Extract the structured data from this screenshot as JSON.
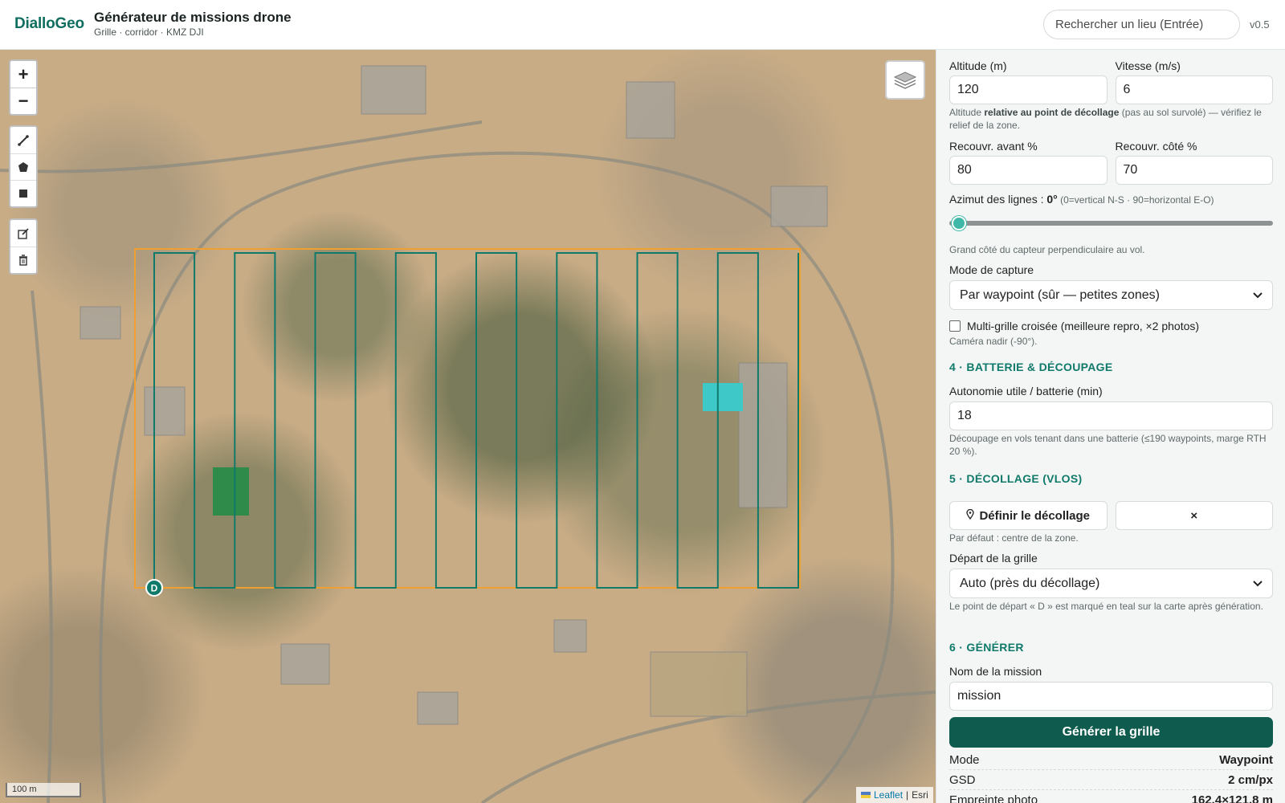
{
  "header": {
    "brand": "DialloGeo",
    "title": "Générateur de missions drone",
    "subtitle": "Grille · corridor · KMZ DJI",
    "search_placeholder": "Rechercher un lieu (Entrée)",
    "version": "v0.5"
  },
  "map": {
    "zoom_in": "+",
    "zoom_out": "−",
    "scale_label": "100 m",
    "attribution_leaflet": "Leaflet",
    "attribution_sep": "|",
    "attribution_esri": "Esri",
    "start_marker": "D",
    "grid_lines": 17,
    "colors": {
      "zone": "#f0a030",
      "grid": "#0f7a6a",
      "marker": "#0f7a6a"
    }
  },
  "sidebar": {
    "altitude": {
      "label": "Altitude (m)",
      "value": "120"
    },
    "speed": {
      "label": "Vitesse (m/s)",
      "value": "6"
    },
    "altitude_help_1": "Altitude ",
    "altitude_help_bold": "relative au point de décollage",
    "altitude_help_2": " (pas au sol survolé) — vérifiez le relief de la zone.",
    "overlap_front": {
      "label": "Recouvr. avant %",
      "value": "80"
    },
    "overlap_side": {
      "label": "Recouvr. côté %",
      "value": "70"
    },
    "azimuth_label": "Azimut des lignes : ",
    "azimuth_value": "0°",
    "azimuth_hint": " (0=vertical N-S · 90=horizontal E-O)",
    "azimuth_level": 0,
    "sensor_help": "Grand côté du capteur perpendiculaire au vol.",
    "capture_mode_label": "Mode de capture",
    "capture_mode_value": "Par waypoint (sûr — petites zones)",
    "multigrid_label": "Multi-grille croisée (meilleure repro, ×2 photos)",
    "multigrid_checked": false,
    "camera_help": "Caméra nadir (-90°).",
    "section4": "4 · BATTERIE & DÉCOUPAGE",
    "battery_label": "Autonomie utile / batterie (min)",
    "battery_value": "18",
    "battery_help": "Découpage en vols tenant dans une batterie (≤190 waypoints, marge RTH 20 %).",
    "section5": "5 · DÉCOLLAGE (VLOS)",
    "takeoff_button": "Définir le décollage",
    "clear_button": "×",
    "takeoff_help": "Par défaut : centre de la zone.",
    "grid_start_label": "Départ de la grille",
    "grid_start_value": "Auto (près du décollage)",
    "grid_start_help": "Le point de départ « D » est marqué en teal sur la carte après génération.",
    "section6": "6 · GÉNÉRER",
    "mission_name_label": "Nom de la mission",
    "mission_name_value": "mission",
    "generate_button": "Générer la grille",
    "stats": [
      {
        "label": "Mode",
        "value": "Waypoint"
      },
      {
        "label": "GSD",
        "value": "2 cm/px"
      },
      {
        "label": "Empreinte photo",
        "value": "162.4×121.8 m"
      }
    ]
  }
}
